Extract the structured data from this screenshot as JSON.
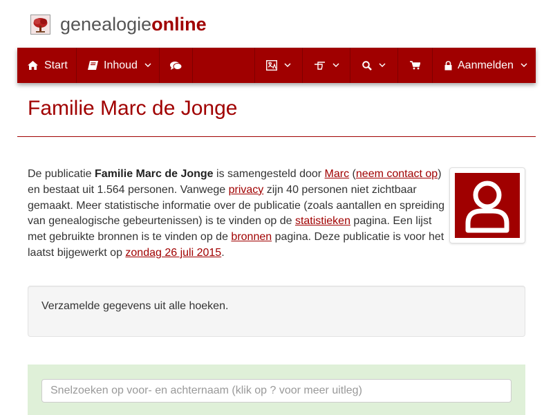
{
  "brand": {
    "part1": "genealogie",
    "part2": "online",
    "logo_icon": "tree-icon"
  },
  "nav": {
    "start_label": "Start",
    "inhoud_label": "Inhoud",
    "aanmelden_label": "Aanmelden",
    "icons": [
      "home-icon",
      "book-icon",
      "comments-icon",
      "language-icon",
      "hand-pointer-icon",
      "search-icon",
      "cart-icon",
      "lock-icon"
    ]
  },
  "page": {
    "title": "Familie Marc de Jonge"
  },
  "intro": {
    "t1": "De publicatie ",
    "pub_name": "Familie Marc de Jonge",
    "t2": " is samengesteld door ",
    "author_link": "Marc",
    "t3": " (",
    "contact_link": "neem contact op",
    "t4": ") en bestaat uit 1.564 personen. Vanwege ",
    "privacy_link": "privacy",
    "t5": " zijn 40 personen niet zichtbaar gemaakt. Meer statistische informatie over de publicatie (zoals aantallen en spreiding van genealogische gebeurtenissen) is te vinden op de ",
    "stats_link": "statistieken",
    "t6": " pagina. Een lijst met gebruikte bronnen is te vinden op de ",
    "sources_link": "bronnen",
    "t7": " pagina. Deze publicatie is voor het laatst bijgewerkt op ",
    "date_link": "zondag 26 juli 2015",
    "t8": "."
  },
  "well": {
    "text": "Verzamelde gegevens uit alle hoeken."
  },
  "search": {
    "placeholder": "Snelzoeken op voor- en achternaam (klik op ? voor meer uitleg)"
  },
  "colors": {
    "brand": "#a00000",
    "search_bg": "#dff0d8",
    "well_bg": "#f5f5f5"
  }
}
